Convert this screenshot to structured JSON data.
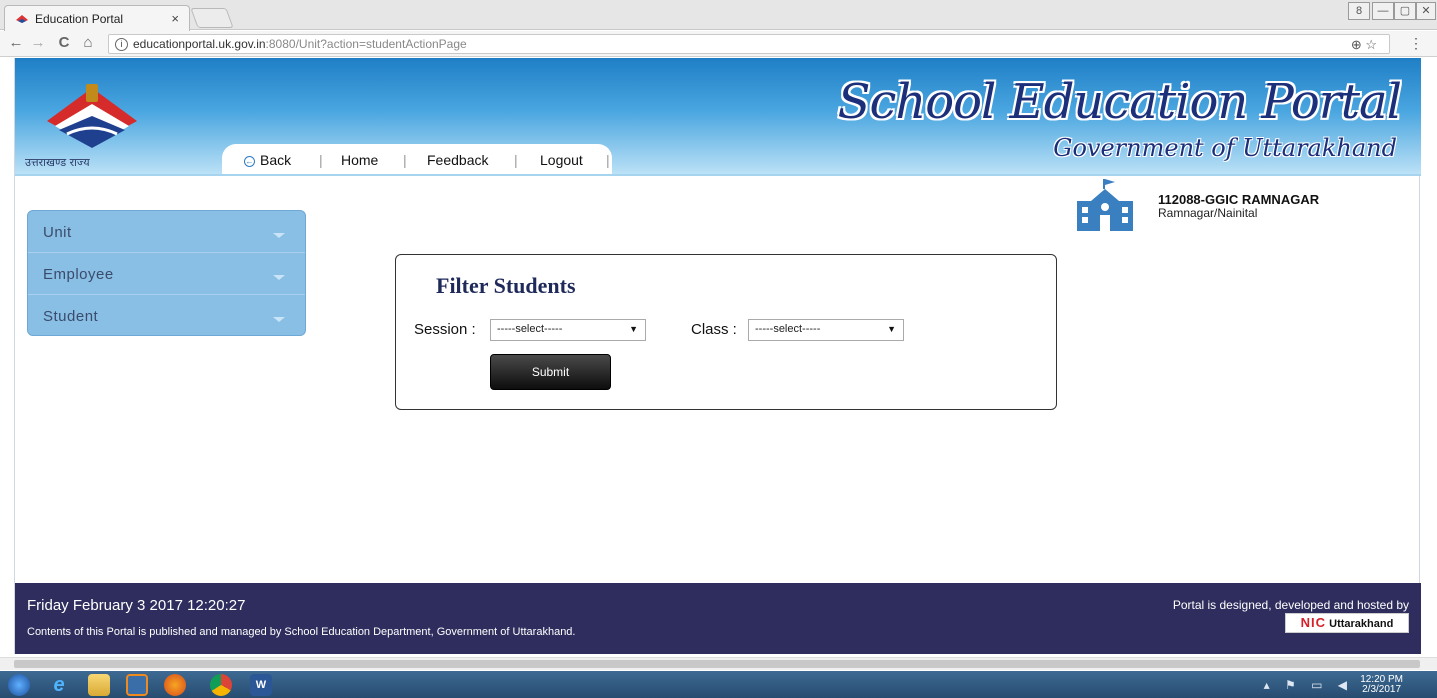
{
  "browser": {
    "tab_title": "Education Portal",
    "tab_close": "×",
    "url_host": "educationportal.uk.gov.in",
    "url_rest": ":8080/Unit?action=studentActionPage",
    "info": "i",
    "omni_icons": "⊕ ☆",
    "menu": "⋮",
    "nav_back": "←",
    "nav_forward": "→",
    "nav_reload": "C",
    "nav_home": "⌂",
    "window_controls": [
      "8",
      "—",
      "▢",
      "✕"
    ]
  },
  "header": {
    "logo_text": "उत्तराखण्ड राज्य",
    "nav": {
      "back": "Back",
      "home": "Home",
      "feedback": "Feedback",
      "logout": "Logout",
      "sep": "|"
    },
    "brand_title": "School Education Portal",
    "brand_subtitle": "Government of Uttarakhand"
  },
  "school": {
    "name": "112088-GGIC RAMNAGAR",
    "place": "Ramnagar/Nainital"
  },
  "sidebar": {
    "items": [
      {
        "label": "Unit"
      },
      {
        "label": "Employee"
      },
      {
        "label": "Student"
      }
    ]
  },
  "filter": {
    "title": "Filter Students",
    "session_label": "Session :",
    "session_value": "-----select-----",
    "class_label": "Class :",
    "class_value": "-----select-----",
    "submit_label": "Submit"
  },
  "footer": {
    "datetime": "Friday February 3 2017 12:20:27",
    "contents": "Contents of this Portal is published and managed by School Education Department, Government of Uttarakhand.",
    "credit": "Portal is designed, developed and hosted by",
    "nic": "NIC",
    "nic_region": "Uttarakhand"
  },
  "taskbar": {
    "time": "12:20 PM",
    "date": "2/3/2017",
    "tray_icons": "▴ ⚑ ▭ ◀"
  },
  "colors": {
    "header_top": "#1f7fc6",
    "sidebar": "#89bfe5",
    "footer": "#2e2d5d",
    "brand": "#1c2f7a"
  }
}
